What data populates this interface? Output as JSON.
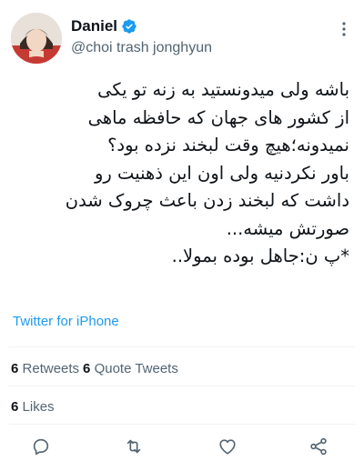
{
  "author": {
    "display_name": "Daniel",
    "handle": "@choi trash jonghyun",
    "verified": true
  },
  "tweet": {
    "text": "باشه ولی میدونستید به زنه تو یکی\nاز کشور های جهان که حافظه ماهی\nنمیدونه؛هیچ وقت لبخند نزده بود؟\nباور نکردنیه ولی اون این ذهنیت رو\nداشت که لبخند زدن باعث چروک شدن\nصورتش میشه...\n*پ ن:جاهل بوده بمولا..",
    "source": "Twitter for iPhone"
  },
  "stats": {
    "retweets_count": "6",
    "retweets_label": "Retweets",
    "quote_tweets_count": "6",
    "quote_tweets_label": "Quote Tweets",
    "likes_count": "6",
    "likes_label": "Likes"
  },
  "icons": {
    "more": "more-vertical-icon",
    "verified": "verified-badge-icon",
    "reply": "reply-icon",
    "retweet": "retweet-icon",
    "like": "heart-icon",
    "share": "share-icon"
  },
  "colors": {
    "accent": "#1d9bf0",
    "text": "#0f1419",
    "secondary": "#536471",
    "divider": "#eff3f4"
  }
}
